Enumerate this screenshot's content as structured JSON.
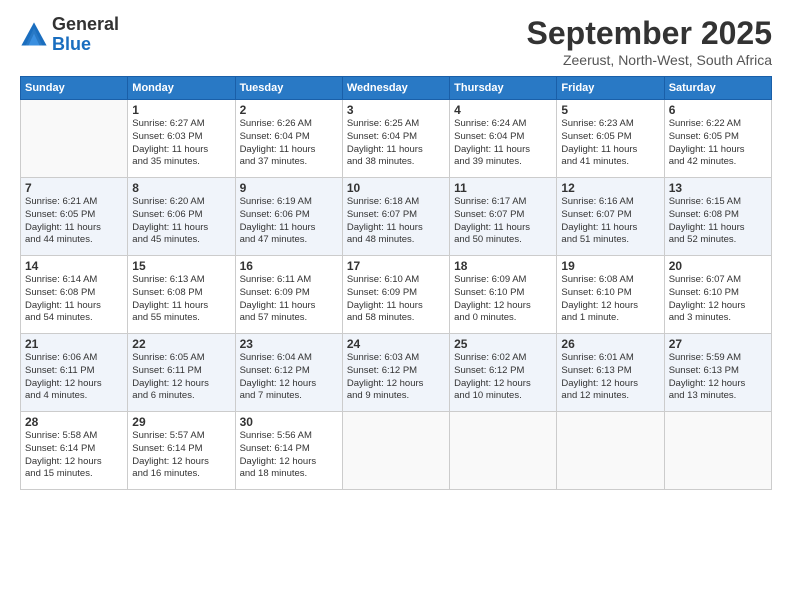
{
  "logo": {
    "general": "General",
    "blue": "Blue"
  },
  "title": "September 2025",
  "location": "Zeerust, North-West, South Africa",
  "days_of_week": [
    "Sunday",
    "Monday",
    "Tuesday",
    "Wednesday",
    "Thursday",
    "Friday",
    "Saturday"
  ],
  "weeks": [
    [
      {
        "day": "",
        "info": ""
      },
      {
        "day": "1",
        "info": "Sunrise: 6:27 AM\nSunset: 6:03 PM\nDaylight: 11 hours\nand 35 minutes."
      },
      {
        "day": "2",
        "info": "Sunrise: 6:26 AM\nSunset: 6:04 PM\nDaylight: 11 hours\nand 37 minutes."
      },
      {
        "day": "3",
        "info": "Sunrise: 6:25 AM\nSunset: 6:04 PM\nDaylight: 11 hours\nand 38 minutes."
      },
      {
        "day": "4",
        "info": "Sunrise: 6:24 AM\nSunset: 6:04 PM\nDaylight: 11 hours\nand 39 minutes."
      },
      {
        "day": "5",
        "info": "Sunrise: 6:23 AM\nSunset: 6:05 PM\nDaylight: 11 hours\nand 41 minutes."
      },
      {
        "day": "6",
        "info": "Sunrise: 6:22 AM\nSunset: 6:05 PM\nDaylight: 11 hours\nand 42 minutes."
      }
    ],
    [
      {
        "day": "7",
        "info": "Sunrise: 6:21 AM\nSunset: 6:05 PM\nDaylight: 11 hours\nand 44 minutes."
      },
      {
        "day": "8",
        "info": "Sunrise: 6:20 AM\nSunset: 6:06 PM\nDaylight: 11 hours\nand 45 minutes."
      },
      {
        "day": "9",
        "info": "Sunrise: 6:19 AM\nSunset: 6:06 PM\nDaylight: 11 hours\nand 47 minutes."
      },
      {
        "day": "10",
        "info": "Sunrise: 6:18 AM\nSunset: 6:07 PM\nDaylight: 11 hours\nand 48 minutes."
      },
      {
        "day": "11",
        "info": "Sunrise: 6:17 AM\nSunset: 6:07 PM\nDaylight: 11 hours\nand 50 minutes."
      },
      {
        "day": "12",
        "info": "Sunrise: 6:16 AM\nSunset: 6:07 PM\nDaylight: 11 hours\nand 51 minutes."
      },
      {
        "day": "13",
        "info": "Sunrise: 6:15 AM\nSunset: 6:08 PM\nDaylight: 11 hours\nand 52 minutes."
      }
    ],
    [
      {
        "day": "14",
        "info": "Sunrise: 6:14 AM\nSunset: 6:08 PM\nDaylight: 11 hours\nand 54 minutes."
      },
      {
        "day": "15",
        "info": "Sunrise: 6:13 AM\nSunset: 6:08 PM\nDaylight: 11 hours\nand 55 minutes."
      },
      {
        "day": "16",
        "info": "Sunrise: 6:11 AM\nSunset: 6:09 PM\nDaylight: 11 hours\nand 57 minutes."
      },
      {
        "day": "17",
        "info": "Sunrise: 6:10 AM\nSunset: 6:09 PM\nDaylight: 11 hours\nand 58 minutes."
      },
      {
        "day": "18",
        "info": "Sunrise: 6:09 AM\nSunset: 6:10 PM\nDaylight: 12 hours\nand 0 minutes."
      },
      {
        "day": "19",
        "info": "Sunrise: 6:08 AM\nSunset: 6:10 PM\nDaylight: 12 hours\nand 1 minute."
      },
      {
        "day": "20",
        "info": "Sunrise: 6:07 AM\nSunset: 6:10 PM\nDaylight: 12 hours\nand 3 minutes."
      }
    ],
    [
      {
        "day": "21",
        "info": "Sunrise: 6:06 AM\nSunset: 6:11 PM\nDaylight: 12 hours\nand 4 minutes."
      },
      {
        "day": "22",
        "info": "Sunrise: 6:05 AM\nSunset: 6:11 PM\nDaylight: 12 hours\nand 6 minutes."
      },
      {
        "day": "23",
        "info": "Sunrise: 6:04 AM\nSunset: 6:12 PM\nDaylight: 12 hours\nand 7 minutes."
      },
      {
        "day": "24",
        "info": "Sunrise: 6:03 AM\nSunset: 6:12 PM\nDaylight: 12 hours\nand 9 minutes."
      },
      {
        "day": "25",
        "info": "Sunrise: 6:02 AM\nSunset: 6:12 PM\nDaylight: 12 hours\nand 10 minutes."
      },
      {
        "day": "26",
        "info": "Sunrise: 6:01 AM\nSunset: 6:13 PM\nDaylight: 12 hours\nand 12 minutes."
      },
      {
        "day": "27",
        "info": "Sunrise: 5:59 AM\nSunset: 6:13 PM\nDaylight: 12 hours\nand 13 minutes."
      }
    ],
    [
      {
        "day": "28",
        "info": "Sunrise: 5:58 AM\nSunset: 6:14 PM\nDaylight: 12 hours\nand 15 minutes."
      },
      {
        "day": "29",
        "info": "Sunrise: 5:57 AM\nSunset: 6:14 PM\nDaylight: 12 hours\nand 16 minutes."
      },
      {
        "day": "30",
        "info": "Sunrise: 5:56 AM\nSunset: 6:14 PM\nDaylight: 12 hours\nand 18 minutes."
      },
      {
        "day": "",
        "info": ""
      },
      {
        "day": "",
        "info": ""
      },
      {
        "day": "",
        "info": ""
      },
      {
        "day": "",
        "info": ""
      }
    ]
  ]
}
